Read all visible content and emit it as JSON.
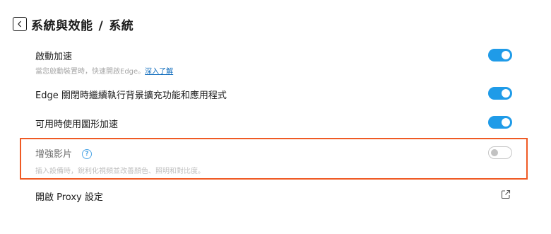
{
  "header": {
    "back_icon": "chevron-left-icon",
    "title_section": "系統與效能",
    "title_separator": "/",
    "title_page": "系統"
  },
  "settings": {
    "startup_boost": {
      "label": "啟動加速",
      "description": "當您啟動裝置時，快速開啟Edge。",
      "link": "深入了解",
      "enabled": true
    },
    "background_apps": {
      "label": "Edge 關閉時繼續執行背景擴充功能和應用程式",
      "enabled": true
    },
    "hardware_acceleration": {
      "label": "可用時使用圖形加速",
      "enabled": true
    },
    "enhance_video": {
      "label": "增強影片",
      "help_icon": "question-icon",
      "help_glyph": "?",
      "description": "插入設備時，銳利化視頻並改善顏色、照明和對比度。",
      "enabled": false,
      "highlight_color": "#ef5a24"
    },
    "proxy": {
      "label": "開啟 Proxy 設定",
      "icon": "external-link-icon"
    }
  },
  "colors": {
    "toggle_on": "#1f9be8",
    "link": "#0f6cbd"
  }
}
